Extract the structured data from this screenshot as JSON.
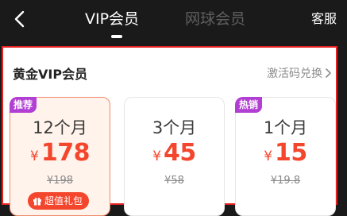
{
  "header": {
    "tabs": [
      {
        "label": "VIP会员",
        "active": true
      },
      {
        "label": "网球会员",
        "active": false
      }
    ],
    "service_label": "客服",
    "back_icon": "chevron-left-icon"
  },
  "panel": {
    "title": "黄金VIP会员",
    "redeem_label": "激活码兑换",
    "border_color": "#e52020",
    "plans": [
      {
        "badge": "推荐",
        "duration": "12个月",
        "currency": "¥",
        "price": "178",
        "original": "¥198",
        "tag": "超值礼包",
        "selected": true
      },
      {
        "badge": "",
        "duration": "3个月",
        "currency": "¥",
        "price": "45",
        "original": "¥58",
        "selected": false
      },
      {
        "badge": "热销",
        "duration": "1个月",
        "currency": "¥",
        "price": "15",
        "original": "¥19.8",
        "selected": false
      }
    ]
  },
  "colors": {
    "accent_price": "#f4462c",
    "badge": "#b23fd3",
    "selected_card_bg": "#fff3ec"
  }
}
